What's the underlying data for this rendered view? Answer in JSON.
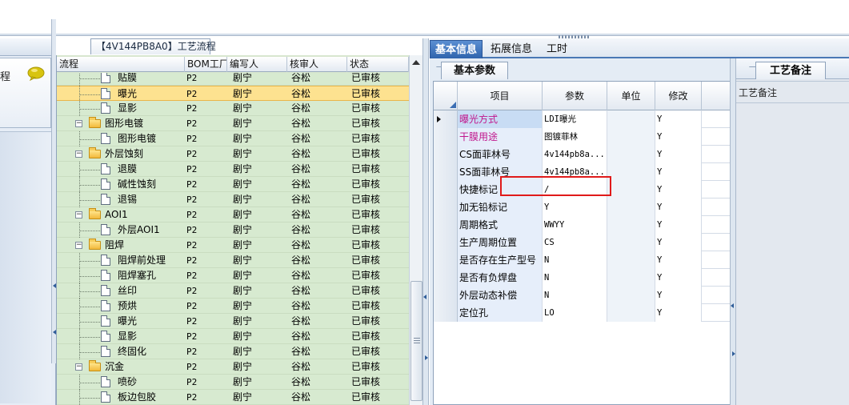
{
  "left_panel": {
    "card_label": "程"
  },
  "process": {
    "tab_label": "【4V144PB8A0】工艺流程",
    "columns": [
      "流程",
      "BOM工厂",
      "编写人",
      "核审人",
      "状态"
    ],
    "rows": [
      {
        "name": "贴膜",
        "bom": "P2",
        "author": "剧宁",
        "reviewer": "谷松",
        "status": "已审核"
      },
      {
        "name": "曝光",
        "bom": "P2",
        "author": "剧宁",
        "reviewer": "谷松",
        "status": "已审核"
      },
      {
        "name": "显影",
        "bom": "P2",
        "author": "剧宁",
        "reviewer": "谷松",
        "status": "已审核"
      },
      {
        "name": "图形电镀",
        "bom": "P2",
        "author": "剧宁",
        "reviewer": "谷松",
        "status": "已审核"
      },
      {
        "name": "图形电镀",
        "bom": "P2",
        "author": "剧宁",
        "reviewer": "谷松",
        "status": "已审核"
      },
      {
        "name": "外层蚀刻",
        "bom": "P2",
        "author": "剧宁",
        "reviewer": "谷松",
        "status": "已审核"
      },
      {
        "name": "退膜",
        "bom": "P2",
        "author": "剧宁",
        "reviewer": "谷松",
        "status": "已审核"
      },
      {
        "name": "碱性蚀刻",
        "bom": "P2",
        "author": "剧宁",
        "reviewer": "谷松",
        "status": "已审核"
      },
      {
        "name": "退锡",
        "bom": "P2",
        "author": "剧宁",
        "reviewer": "谷松",
        "status": "已审核"
      },
      {
        "name": "AOI1",
        "bom": "P2",
        "author": "剧宁",
        "reviewer": "谷松",
        "status": "已审核"
      },
      {
        "name": "外层AOI1",
        "bom": "P2",
        "author": "剧宁",
        "reviewer": "谷松",
        "status": "已审核"
      },
      {
        "name": "阻焊",
        "bom": "P2",
        "author": "剧宁",
        "reviewer": "谷松",
        "status": "已审核"
      },
      {
        "name": "阻焊前处理",
        "bom": "P2",
        "author": "剧宁",
        "reviewer": "谷松",
        "status": "已审核"
      },
      {
        "name": "阻焊塞孔",
        "bom": "P2",
        "author": "剧宁",
        "reviewer": "谷松",
        "status": "已审核"
      },
      {
        "name": "丝印",
        "bom": "P2",
        "author": "剧宁",
        "reviewer": "谷松",
        "status": "已审核"
      },
      {
        "name": "预烘",
        "bom": "P2",
        "author": "剧宁",
        "reviewer": "谷松",
        "status": "已审核"
      },
      {
        "name": "曝光",
        "bom": "P2",
        "author": "剧宁",
        "reviewer": "谷松",
        "status": "已审核"
      },
      {
        "name": "显影",
        "bom": "P2",
        "author": "剧宁",
        "reviewer": "谷松",
        "status": "已审核"
      },
      {
        "name": "终固化",
        "bom": "P2",
        "author": "剧宁",
        "reviewer": "谷松",
        "status": "已审核"
      },
      {
        "name": "沉金",
        "bom": "P2",
        "author": "剧宁",
        "reviewer": "谷松",
        "status": "已审核"
      },
      {
        "name": "喷砂",
        "bom": "P2",
        "author": "剧宁",
        "reviewer": "谷松",
        "status": "已审核"
      },
      {
        "name": "板边包胶",
        "bom": "P2",
        "author": "剧宁",
        "reviewer": "谷松",
        "status": "已审核"
      }
    ]
  },
  "tabs": [
    "基本信息",
    "拓展信息",
    "工时"
  ],
  "params": {
    "sub_tab": "基本参数",
    "columns": [
      "项目",
      "参数",
      "单位",
      "修改"
    ],
    "rows": [
      {
        "item": "曝光方式",
        "value": "LDI曝光",
        "unit": "",
        "modify": "Y"
      },
      {
        "item": "干膜用途",
        "value": "图镀菲林",
        "unit": "",
        "modify": "Y"
      },
      {
        "item": "CS面菲林号",
        "value": "4v144pb8a...",
        "unit": "",
        "modify": "Y"
      },
      {
        "item": "SS面菲林号",
        "value": "4v144pb8a...",
        "unit": "",
        "modify": "Y"
      },
      {
        "item": "快捷标记",
        "value": "/",
        "unit": "",
        "modify": "Y"
      },
      {
        "item": "加无铅标记",
        "value": "Y",
        "unit": "",
        "modify": "Y"
      },
      {
        "item": "周期格式",
        "value": "WWYY",
        "unit": "",
        "modify": "Y"
      },
      {
        "item": "生产周期位置",
        "value": "CS",
        "unit": "",
        "modify": "Y"
      },
      {
        "item": "是否存在生产型号",
        "value": "N",
        "unit": "",
        "modify": "Y"
      },
      {
        "item": "是否有负焊盘",
        "value": "N",
        "unit": "",
        "modify": "Y"
      },
      {
        "item": "外层动态补偿",
        "value": "N",
        "unit": "",
        "modify": "Y"
      },
      {
        "item": "定位孔",
        "value": "LO",
        "unit": "",
        "modify": "Y"
      }
    ]
  },
  "notes": {
    "tab": "工艺备注",
    "label": "工艺备注"
  },
  "colors": {
    "accent_tab": "#2f64ad",
    "tree_background": "#d7ead0",
    "selected_row": "#fde290",
    "magenta_item": "#c0168c",
    "highlight_box": "#e01a1a"
  }
}
